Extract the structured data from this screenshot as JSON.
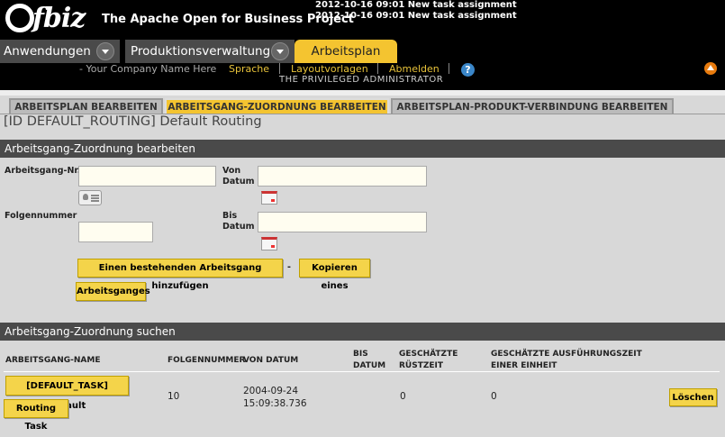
{
  "header": {
    "logo": "fbiz",
    "tagline": "The Apache Open for Business Project",
    "alerts": [
      "2012-10-16 09:01 New task assignment",
      "2012-10-16 09:01 New task assignment"
    ]
  },
  "apptabs": [
    {
      "label": "Anwendungen"
    },
    {
      "label": "Produktionsverwaltung"
    },
    {
      "label": "Arbeitsplan"
    }
  ],
  "userbar": {
    "company": "- Your Company Name Here",
    "links": [
      "Sprache",
      "Layoutvorlagen",
      "Abmelden"
    ],
    "user": "THE PRIVILEGED ADMINISTRATOR",
    "help": "?"
  },
  "subtabs": [
    "ARBEITSPLAN BEARBEITEN",
    "ARBEITSGANG-ZUORDNUNG BEARBEITEN",
    "ARBEITSPLAN-PRODUKT-VERBINDUNG BEARBEITEN"
  ],
  "page_title": "[ID DEFAULT_ROUTING] Default Routing",
  "edit_section": {
    "title": "Arbeitsgang-Zuordnung bearbeiten",
    "labels": {
      "task_id": "Arbeitsgang-Nr.",
      "seq": "Folgennummer",
      "from_date": "Von Datum",
      "thru_date": "Bis Datum"
    },
    "values": {
      "task_id": "",
      "seq": "",
      "from_date": "",
      "thru_date": ""
    },
    "add_button": "Einen bestehenden Arbeitsgang hinzufügen",
    "dash": "-",
    "copy_button_1": "Kopieren eines",
    "copy_button_2": "Arbeitsganges"
  },
  "search_section": {
    "title": "Arbeitsgang-Zuordnung suchen",
    "columns": [
      "ARBEITSGANG-NAME",
      "FOLGENNUMMER",
      "VON DATUM",
      "BIS DATUM",
      "GESCHÄTZTE RÜSTZEIT",
      "GESCHÄTZTE AUSFÜHRUNGSZEIT EINER EINHEIT"
    ],
    "rows": [
      {
        "task_line1": "[DEFAULT_TASK] Default",
        "task_line2": "Routing Task",
        "seq": "10",
        "from_date": "2004-09-24",
        "from_time": "15:09:38.736",
        "thru_date": "",
        "setup_time": "0",
        "run_time": "0",
        "delete": "Löschen"
      }
    ]
  }
}
